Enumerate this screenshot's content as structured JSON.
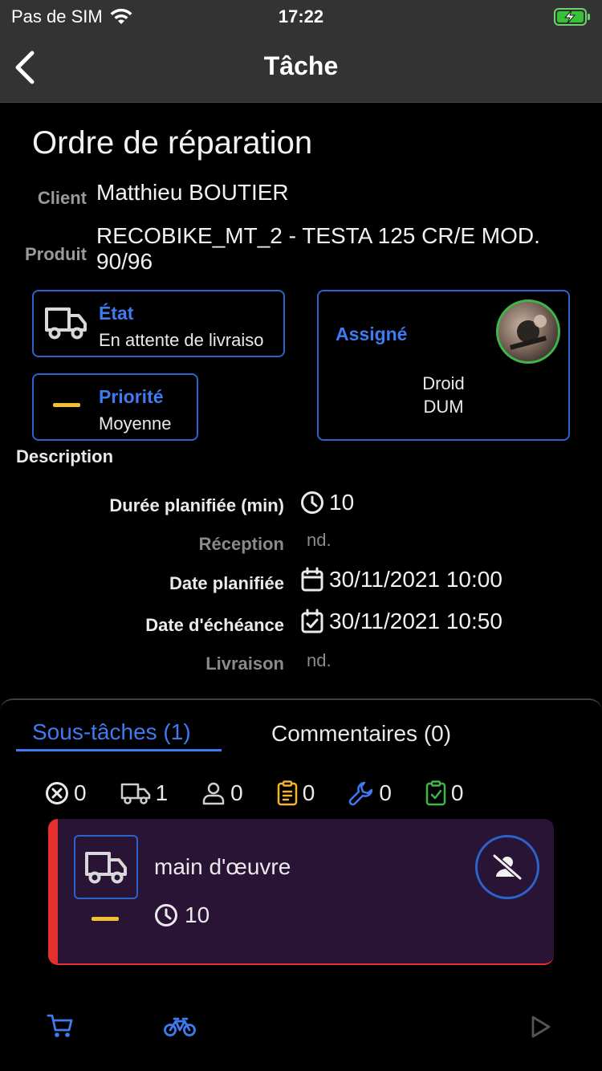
{
  "status_bar": {
    "carrier": "Pas de SIM",
    "time": "17:22"
  },
  "nav": {
    "title": "Tâche"
  },
  "heading": "Ordre de réparation",
  "client": {
    "label": "Client",
    "value": "Matthieu BOUTIER"
  },
  "product": {
    "label": "Produit",
    "line1": "RECOBIKE_MT_2 - TESTA 125 CR/E MOD.",
    "line2": "90/96"
  },
  "state_card": {
    "label": "État",
    "value": "En attente de livraiso"
  },
  "priority_card": {
    "label": "Priorité",
    "value": "Moyenne"
  },
  "assigned_card": {
    "label": "Assigné",
    "name_line1": "Droid",
    "name_line2": "DUM"
  },
  "description": {
    "title": "Description",
    "rows": [
      {
        "label": "Durée planifiée (min)",
        "value": "10"
      },
      {
        "label": "Réception",
        "value": "nd."
      },
      {
        "label": "Date planifiée",
        "value": "30/11/2021 10:00"
      },
      {
        "label": "Date d'échéance",
        "value": "30/11/2021 10:50"
      },
      {
        "label": "Livraison",
        "value": "nd."
      }
    ]
  },
  "tabs": [
    {
      "label": "Sous-tâches (1)"
    },
    {
      "label": "Commentaires (0)"
    }
  ],
  "counts": [
    "0",
    "1",
    "0",
    "0",
    "0",
    "0"
  ],
  "subtask": {
    "name": "main d'œuvre",
    "duration": "10"
  },
  "colors": {
    "accent": "#3f7af0",
    "priority_medium": "#f2c12e",
    "danger": "#e53030",
    "success": "#3fb54a",
    "subtask_bg": "#2a1436"
  }
}
